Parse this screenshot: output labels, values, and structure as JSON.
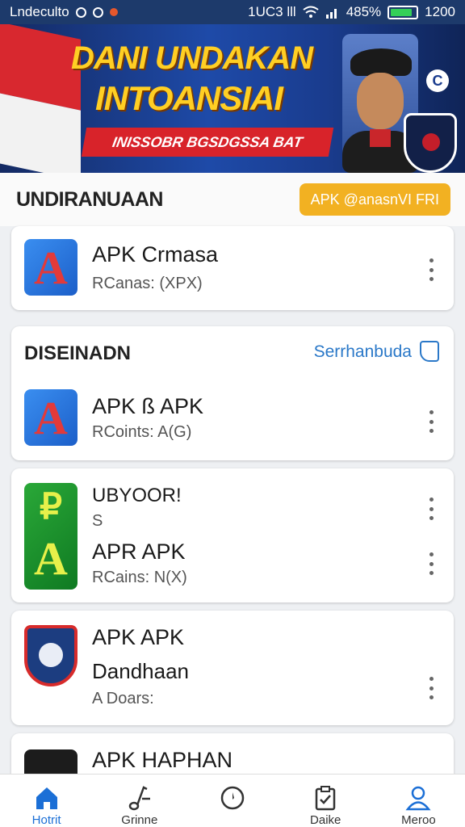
{
  "status_bar": {
    "carrier": "Lndeᴄulto",
    "right_text": "1UC3 lll",
    "battery_percent_label": "485%",
    "time": "1200",
    "battery_level": 0.85
  },
  "banner": {
    "title_line1": "DANI UNDAKAN",
    "title_line2": "INTOANSIAI",
    "ribbon": "INISSOBR BGSDGSSA BAT",
    "corner_badge": "C"
  },
  "section": {
    "title": "UNDIRANUAAN",
    "button_label": "APK @anasnVI FRI"
  },
  "featured_app": {
    "name": "APK Crmasa",
    "sub": "RCanas: (XPX)"
  },
  "group": {
    "title": "DISEINADN",
    "link_label": "Serrhanbuda"
  },
  "apps": [
    {
      "name": "APK ß APK",
      "sub": "RCoints: A(G)"
    },
    {
      "name": "UBYOOR!",
      "name2": "S",
      "title": "APR APK",
      "sub": "RCains: N(X)"
    },
    {
      "name": "APK APK",
      "name2": "Dandhaan",
      "sub": "A Doars:"
    },
    {
      "name": "APK HAPHAN"
    }
  ],
  "bottom_nav": [
    {
      "label": "Hotrit",
      "icon": "home-icon",
      "active": true
    },
    {
      "label": "Grinne",
      "icon": "music-note-icon",
      "active": false
    },
    {
      "label": "",
      "icon": "compass-icon",
      "active": false
    },
    {
      "label": "Daike",
      "icon": "clipboard-check-icon",
      "active": false
    },
    {
      "label": "Meroo",
      "icon": "user-icon",
      "active": false
    }
  ],
  "colors": {
    "accent": "#f2b122",
    "link": "#2a78c8",
    "active_nav": "#1b6fd6",
    "status_bar": "#1d3a6b"
  }
}
